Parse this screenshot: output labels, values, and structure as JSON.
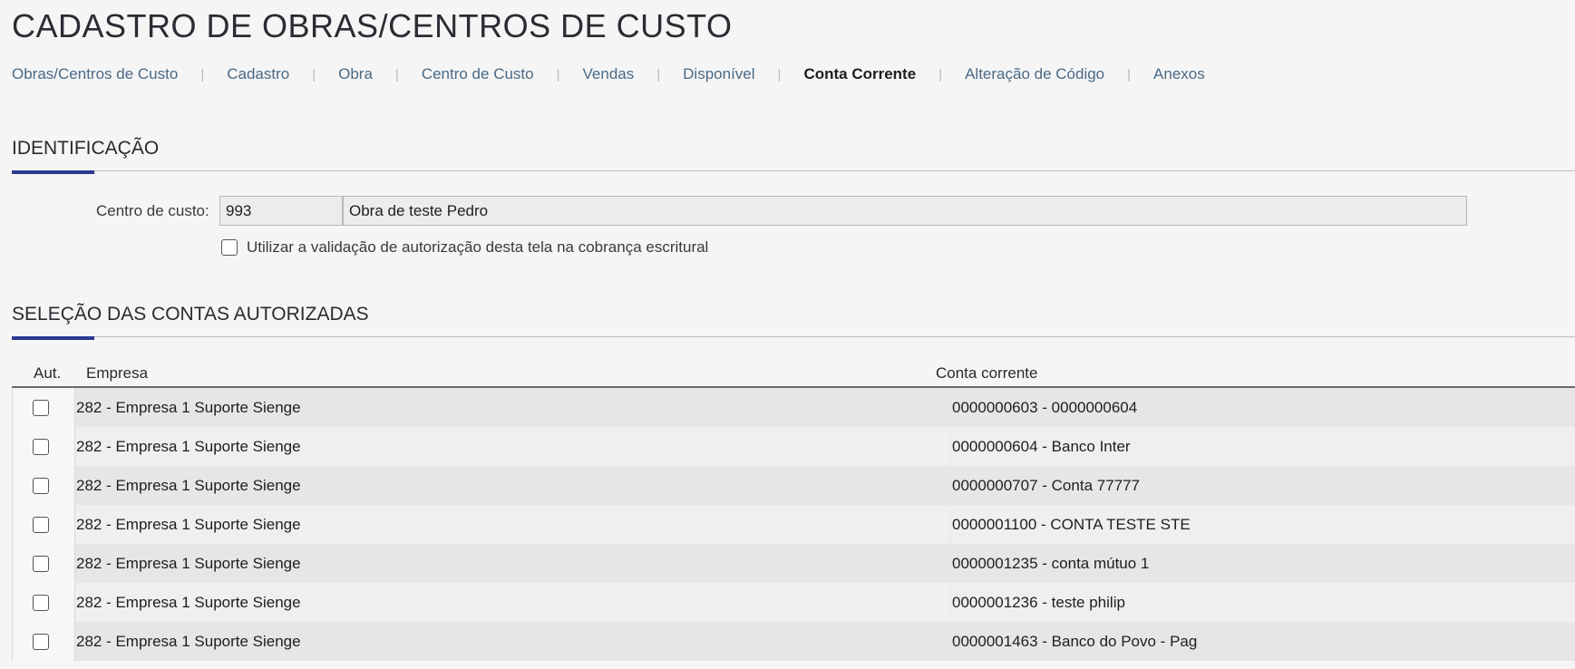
{
  "page": {
    "title": "CADASTRO DE OBRAS/CENTROS DE CUSTO"
  },
  "tabs": [
    {
      "label": "Obras/Centros de Custo",
      "active": false
    },
    {
      "label": "Cadastro",
      "active": false
    },
    {
      "label": "Obra",
      "active": false
    },
    {
      "label": "Centro de Custo",
      "active": false
    },
    {
      "label": "Vendas",
      "active": false
    },
    {
      "label": "Disponível",
      "active": false
    },
    {
      "label": "Conta Corrente",
      "active": true
    },
    {
      "label": "Alteração de Código",
      "active": false
    },
    {
      "label": "Anexos",
      "active": false
    }
  ],
  "identificacao": {
    "title": "IDENTIFICAÇÃO",
    "centro_label": "Centro de custo:",
    "centro_code": "993",
    "centro_name": "Obra de teste Pedro",
    "validation_label": "Utilizar a validação de autorização desta tela na cobrança escritural",
    "validation_checked": false
  },
  "selecao": {
    "title": "SELEÇÃO DAS CONTAS AUTORIZADAS",
    "columns": {
      "aut": "Aut.",
      "empresa": "Empresa",
      "conta": "Conta corrente"
    },
    "rows": [
      {
        "empresa": "282 - Empresa 1 Suporte Sienge",
        "conta": "0000000603 - 0000000604",
        "checked": false
      },
      {
        "empresa": "282 - Empresa 1 Suporte Sienge",
        "conta": "0000000604 - Banco Inter",
        "checked": false
      },
      {
        "empresa": "282 - Empresa 1 Suporte Sienge",
        "conta": "0000000707 - Conta 77777",
        "checked": false
      },
      {
        "empresa": "282 - Empresa 1 Suporte Sienge",
        "conta": "0000001100 - CONTA TESTE STE",
        "checked": false
      },
      {
        "empresa": "282 - Empresa 1 Suporte Sienge",
        "conta": "0000001235 - conta mútuo 1",
        "checked": false
      },
      {
        "empresa": "282 - Empresa 1 Suporte Sienge",
        "conta": "0000001236 - teste philip",
        "checked": false
      },
      {
        "empresa": "282 - Empresa 1 Suporte Sienge",
        "conta": "0000001463 - Banco do Povo - Pag",
        "checked": false
      }
    ]
  },
  "colors": {
    "accent": "#2a3990",
    "tab_link": "#4a6a86",
    "row_dark": "#e6e6e6",
    "row_light": "#efefef"
  }
}
